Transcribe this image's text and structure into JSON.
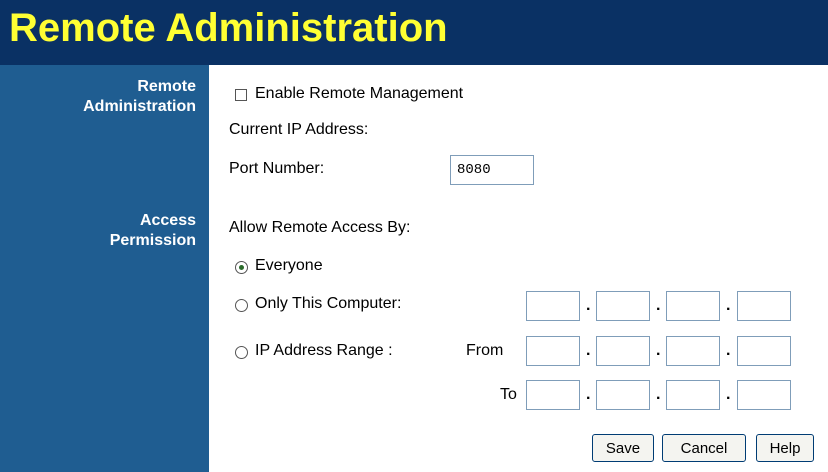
{
  "header": {
    "title": "Remote Administration"
  },
  "sections": {
    "remote_administration": [
      "Remote",
      "Administration"
    ],
    "access_permission": [
      "Access",
      "Permission"
    ]
  },
  "remote": {
    "enable_label": "Enable Remote Management",
    "enable_checked": false,
    "current_ip_label": "Current IP Address:",
    "port_label": "Port Number:",
    "port_value": "8080"
  },
  "access": {
    "allow_label": "Allow Remote Access By:",
    "options": {
      "everyone": "Everyone",
      "only_this_computer": "Only This Computer:",
      "ip_range": "IP Address Range :"
    },
    "selected": "everyone",
    "from_label": "From",
    "to_label": "To",
    "dot": "."
  },
  "buttons": {
    "save": "Save",
    "cancel": "Cancel",
    "help": "Help"
  },
  "colors": {
    "header_bg": "#0a3164",
    "title": "#ffff33",
    "sidebar_bg": "#1f5d91"
  }
}
